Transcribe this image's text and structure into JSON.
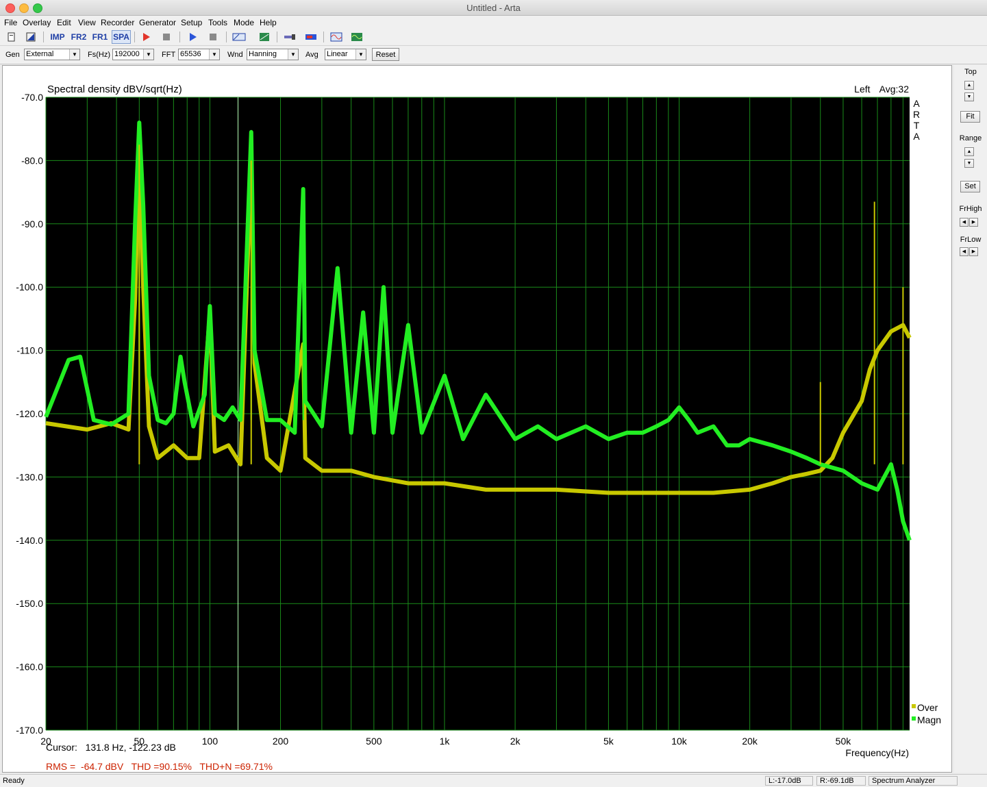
{
  "window": {
    "title": "Untitled - Arta"
  },
  "menu": [
    "File",
    "Overlay",
    "Edit",
    "View",
    "Recorder",
    "Generator",
    "Setup",
    "Tools",
    "Mode",
    "Help"
  ],
  "toolbar": {
    "imp": "IMP",
    "fr2": "FR2",
    "fr1": "FR1",
    "spa": "SPA"
  },
  "params": {
    "gen_label": "Gen",
    "gen_value": "External",
    "fs_label": "Fs(Hz)",
    "fs_value": "192000",
    "fft_label": "FFT",
    "fft_value": "65536",
    "wnd_label": "Wnd",
    "wnd_value": "Hanning",
    "avg_label": "Avg",
    "avg_value": "Linear",
    "reset": "Reset"
  },
  "side": {
    "top": "Top",
    "fit": "Fit",
    "range": "Range",
    "set": "Set",
    "frhigh": "FrHigh",
    "frlow": "FrLow"
  },
  "readouts": {
    "channel": "Left",
    "avg": "Avg:32",
    "cursor": "Cursor:   131.8 Hz, -122.23 dB",
    "stats": "RMS =  -64.7 dBV   THD =90.15%   THD+N =69.71%"
  },
  "brand": [
    "A",
    "R",
    "T",
    "A"
  ],
  "status": {
    "ready": "Ready",
    "left": "L:-17.0dB",
    "right": "R:-69.1dB",
    "mode": "Spectrum Analyzer"
  },
  "colors": {
    "plot_bg": "#000000",
    "grid": "#1a8c1a",
    "over": "#c8c800",
    "magn": "#22ee22",
    "cursor": "#b8ffb8",
    "stats": "#cc2200"
  },
  "chart_data": {
    "type": "line",
    "title": "Spectral density dBV/sqrt(Hz)",
    "xlabel": "Frequency(Hz)",
    "ylabel": "",
    "x_scale": "log",
    "xlim": [
      20,
      96000
    ],
    "ylim": [
      -170,
      -70
    ],
    "x_ticks": [
      20,
      50,
      100,
      200,
      500,
      1000,
      2000,
      5000,
      10000,
      20000,
      50000
    ],
    "x_tick_labels": [
      "20",
      "50",
      "100",
      "200",
      "500",
      "1k",
      "2k",
      "5k",
      "10k",
      "20k",
      "50k"
    ],
    "y_ticks": [
      -70,
      -80,
      -90,
      -100,
      -110,
      -120,
      -130,
      -140,
      -150,
      -160,
      -170
    ],
    "y_tick_labels": [
      "-70.0",
      "-80.0",
      "-90.0",
      "-100.0",
      "-110.0",
      "-120.0",
      "-130.0",
      "-140.0",
      "-150.0",
      "-160.0",
      "-170.0"
    ],
    "cursor_hz": 131.8,
    "legend": [
      "Over",
      "Magn"
    ],
    "legend_position": "bottom-right",
    "grid": true,
    "series": [
      {
        "name": "Magn",
        "color": "#22ee22",
        "points": [
          [
            20,
            -120.5
          ],
          [
            25,
            -111.5
          ],
          [
            28,
            -111
          ],
          [
            32,
            -121
          ],
          [
            38,
            -121.7
          ],
          [
            45,
            -120
          ],
          [
            48,
            -90
          ],
          [
            50,
            -74
          ],
          [
            52,
            -87
          ],
          [
            55,
            -114
          ],
          [
            60,
            -121
          ],
          [
            65,
            -121.5
          ],
          [
            70,
            -120
          ],
          [
            75,
            -111
          ],
          [
            78,
            -115
          ],
          [
            85,
            -122
          ],
          [
            95,
            -117
          ],
          [
            100,
            -103
          ],
          [
            105,
            -120
          ],
          [
            115,
            -121
          ],
          [
            125,
            -119
          ],
          [
            135,
            -121
          ],
          [
            150,
            -75.5
          ],
          [
            155,
            -110
          ],
          [
            175,
            -121
          ],
          [
            200,
            -121
          ],
          [
            230,
            -123
          ],
          [
            250,
            -84.5
          ],
          [
            255,
            -118
          ],
          [
            300,
            -122
          ],
          [
            350,
            -97
          ],
          [
            400,
            -123
          ],
          [
            450,
            -104
          ],
          [
            500,
            -123
          ],
          [
            550,
            -100
          ],
          [
            600,
            -123
          ],
          [
            700,
            -106
          ],
          [
            800,
            -123
          ],
          [
            1000,
            -114
          ],
          [
            1200,
            -124
          ],
          [
            1500,
            -117
          ],
          [
            2000,
            -124
          ],
          [
            2500,
            -122
          ],
          [
            3000,
            -124
          ],
          [
            4000,
            -122
          ],
          [
            5000,
            -124
          ],
          [
            6000,
            -123
          ],
          [
            7000,
            -123
          ],
          [
            8000,
            -122
          ],
          [
            9000,
            -121
          ],
          [
            10000,
            -119
          ],
          [
            11000,
            -121
          ],
          [
            12000,
            -123
          ],
          [
            14000,
            -122
          ],
          [
            16000,
            -125
          ],
          [
            18000,
            -125
          ],
          [
            20000,
            -124
          ],
          [
            25000,
            -125
          ],
          [
            30000,
            -126
          ],
          [
            35000,
            -127
          ],
          [
            40000,
            -128
          ],
          [
            50000,
            -129
          ],
          [
            60000,
            -131
          ],
          [
            70000,
            -132
          ],
          [
            80000,
            -128
          ],
          [
            85000,
            -132
          ],
          [
            90000,
            -137
          ],
          [
            96000,
            -140
          ]
        ]
      },
      {
        "name": "Over",
        "color": "#c8c800",
        "points": [
          [
            20,
            -121.5
          ],
          [
            30,
            -122.5
          ],
          [
            38,
            -121.5
          ],
          [
            45,
            -122.5
          ],
          [
            48,
            -102
          ],
          [
            50,
            -77.5
          ],
          [
            52,
            -100
          ],
          [
            55,
            -122
          ],
          [
            60,
            -127
          ],
          [
            70,
            -125
          ],
          [
            80,
            -127
          ],
          [
            90,
            -127
          ],
          [
            100,
            -104
          ],
          [
            105,
            -126
          ],
          [
            120,
            -125
          ],
          [
            135,
            -128
          ],
          [
            150,
            -80
          ],
          [
            155,
            -112
          ],
          [
            175,
            -127
          ],
          [
            200,
            -129
          ],
          [
            250,
            -109
          ],
          [
            255,
            -127
          ],
          [
            300,
            -129
          ],
          [
            400,
            -129
          ],
          [
            500,
            -130
          ],
          [
            700,
            -131
          ],
          [
            1000,
            -131
          ],
          [
            1500,
            -132
          ],
          [
            2000,
            -132
          ],
          [
            3000,
            -132
          ],
          [
            5000,
            -132.5
          ],
          [
            7000,
            -132.5
          ],
          [
            10000,
            -132.5
          ],
          [
            14000,
            -132.5
          ],
          [
            20000,
            -132
          ],
          [
            25000,
            -131
          ],
          [
            30000,
            -130
          ],
          [
            35000,
            -129.5
          ],
          [
            40000,
            -129
          ],
          [
            45000,
            -127
          ],
          [
            50000,
            -123
          ],
          [
            60000,
            -118
          ],
          [
            65000,
            -113
          ],
          [
            70000,
            -110
          ],
          [
            80000,
            -107
          ],
          [
            90000,
            -106
          ],
          [
            96000,
            -108
          ]
        ]
      }
    ],
    "peaks": [
      {
        "series": "Magn",
        "x": 50,
        "y": -74
      },
      {
        "series": "Magn",
        "x": 150,
        "y": -75.5
      },
      {
        "series": "Magn",
        "x": 250,
        "y": -84.5
      },
      {
        "series": "Over",
        "x": 50,
        "y": -77.5
      },
      {
        "series": "Over",
        "x": 150,
        "y": -80
      },
      {
        "series": "Over",
        "x": 68000,
        "y": -86.5
      },
      {
        "series": "Over",
        "x": 40000,
        "y": -115
      },
      {
        "series": "Over",
        "x": 90000,
        "y": -100
      }
    ]
  }
}
